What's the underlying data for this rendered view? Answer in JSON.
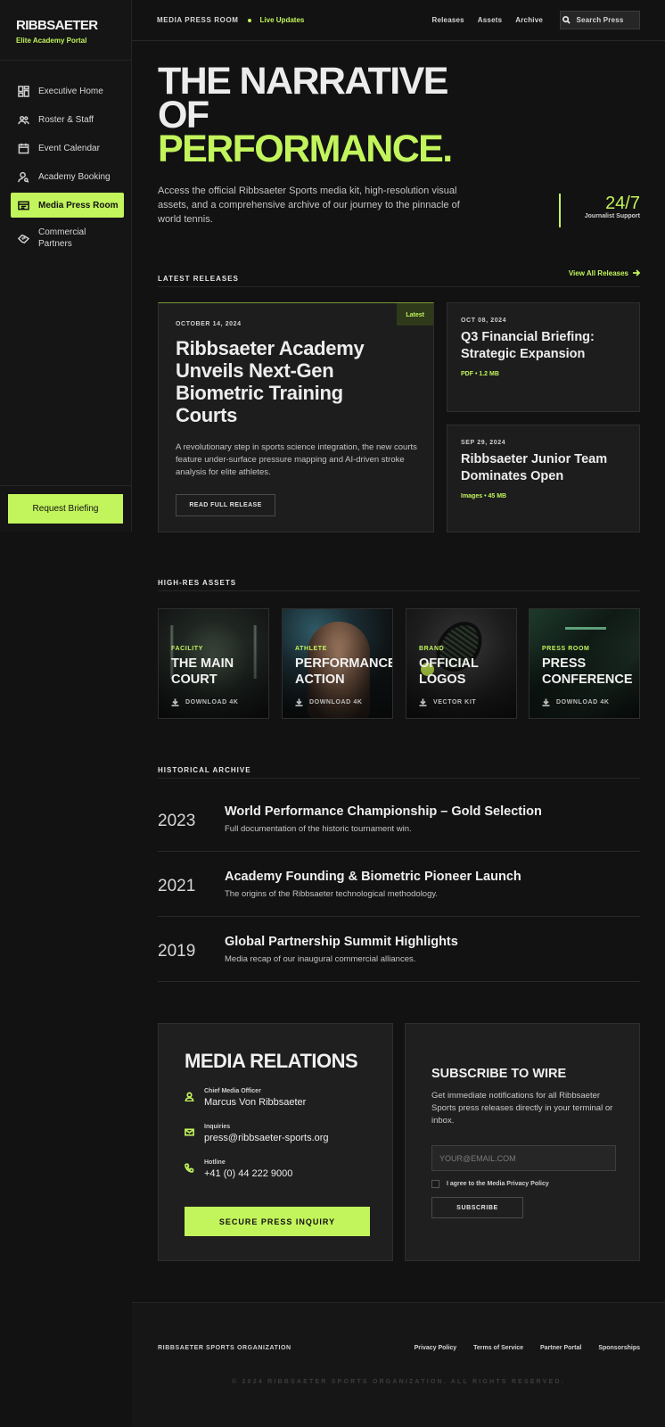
{
  "brand": {
    "name": "RIBBSAETER",
    "subtitle": "Elite Academy Portal"
  },
  "sidebar": {
    "items": [
      {
        "label": "Executive Home",
        "icon": "dashboard-icon"
      },
      {
        "label": "Roster & Staff",
        "icon": "group-icon"
      },
      {
        "label": "Event Calendar",
        "icon": "calendar-icon"
      },
      {
        "label": "Academy Booking",
        "icon": "person-search-icon"
      },
      {
        "label": "Media Press Room",
        "icon": "newspaper-icon",
        "active": true
      },
      {
        "label": "Commercial Partners",
        "icon": "handshake-icon"
      }
    ],
    "cta": "Request Briefing"
  },
  "topbar": {
    "section": "MEDIA PRESS ROOM",
    "live": "Live Updates",
    "links": [
      "Releases",
      "Assets",
      "Archive"
    ],
    "search": "Search Press"
  },
  "hero": {
    "line1": "THE NARRATIVE",
    "line2": "OF",
    "line3": "PERFORMANCE.",
    "intro": "Access the official Ribbsaeter Sports media kit, high-resolution visual assets, and a comprehensive archive of our journey to the pinnacle of world tennis.",
    "support_value": "24/7",
    "support_label": "Journalist Support"
  },
  "releases": {
    "heading": "LATEST RELEASES",
    "view_all": "View All Releases",
    "featured": {
      "badge": "Latest",
      "date": "OCTOBER 14, 2024",
      "title": "Ribbsaeter Academy Unveils Next-Gen Biometric Training Courts",
      "description": "A revolutionary step in sports science integration, the new courts feature under-surface pressure mapping and AI-driven stroke analysis for elite athletes.",
      "cta": "READ FULL RELEASE"
    },
    "cards": [
      {
        "date": "OCT 08, 2024",
        "title": "Q3 Financial Briefing: Strategic Expansion",
        "meta": "PDF • 1.2 MB"
      },
      {
        "date": "SEP 29, 2024",
        "title": "Ribbsaeter Junior Team Dominates Open",
        "meta": "Images • 45 MB"
      }
    ]
  },
  "assets": {
    "heading": "HIGH-RES ASSETS",
    "items": [
      {
        "category": "FACILITY",
        "title": "THE MAIN COURT",
        "action": "DOWNLOAD 4K"
      },
      {
        "category": "ATHLETE",
        "title": "PERFORMANCE ACTION",
        "action": "DOWNLOAD 4K"
      },
      {
        "category": "BRAND",
        "title": "OFFICIAL LOGOS",
        "action": "VECTOR KIT"
      },
      {
        "category": "PRESS ROOM",
        "title": "PRESS CONFERENCE",
        "action": "DOWNLOAD 4K"
      }
    ]
  },
  "archive": {
    "heading": "HISTORICAL ARCHIVE",
    "rows": [
      {
        "year": "2023",
        "title": "World Performance Championship – Gold Selection",
        "subtitle": "Full documentation of the historic tournament win."
      },
      {
        "year": "2021",
        "title": "Academy Founding & Biometric Pioneer Launch",
        "subtitle": "The origins of the Ribbsaeter technological methodology."
      },
      {
        "year": "2019",
        "title": "Global Partnership Summit Highlights",
        "subtitle": "Media recap of our inaugural commercial alliances."
      }
    ]
  },
  "media_relations": {
    "heading": "MEDIA RELATIONS",
    "contacts": [
      {
        "label": "Chief Media Officer",
        "value": "Marcus Von Ribbsaeter",
        "icon": "person-icon"
      },
      {
        "label": "Inquiries",
        "value": "press@ribbsaeter-sports.org",
        "icon": "mail-icon"
      },
      {
        "label": "Hotline",
        "value": "+41 (0) 44 222 9000",
        "icon": "phone-icon"
      }
    ],
    "cta": "SECURE PRESS INQUIRY"
  },
  "subscribe": {
    "heading": "SUBSCRIBE TO WIRE",
    "description": "Get immediate notifications for all Ribbsaeter Sports press releases directly in your terminal or inbox.",
    "placeholder": "YOUR@EMAIL.COM",
    "agree": "I agree to the Media Privacy Policy",
    "button": "SUBSCRIBE"
  },
  "footer": {
    "org": "RIBBSAETER SPORTS ORGANIZATION",
    "links": [
      "Privacy Policy",
      "Terms of Service",
      "Partner Portal",
      "Sponsorships"
    ],
    "copyright": "© 2024 RIBBSAETER SPORTS ORGANIZATION. ALL RIGHTS RESERVED."
  },
  "colors": {
    "accent": "#c2f45c",
    "background": "#121212",
    "panel": "#1d1d1d"
  }
}
